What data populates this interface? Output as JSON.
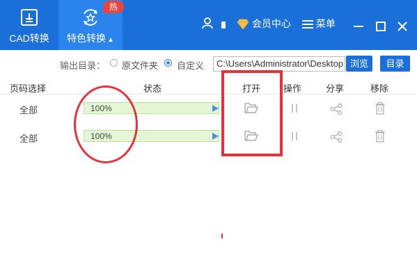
{
  "topbar": {
    "cad_label": "CAD转换",
    "special_label": "特色转换",
    "hot_badge": "热",
    "member_center": "会员中心",
    "menu_label": "菜单",
    "brand_color": "#1b6fd8"
  },
  "output": {
    "label": "输出目录：",
    "options": [
      "原文件夹",
      "自定义"
    ],
    "selected": "自定义",
    "path_value": "C:\\Users\\Administrator\\Desktop",
    "browse_label": "浏览",
    "dir_label": "目录"
  },
  "table": {
    "columns": {
      "page": "页码选择",
      "status": "状态",
      "open": "打开",
      "operate": "操作",
      "share": "分享",
      "remove": "移除"
    },
    "rows": [
      {
        "page": "全部",
        "progress": "100%",
        "progress_value": 100
      },
      {
        "page": "全部",
        "progress": "100%",
        "progress_value": 100
      }
    ]
  },
  "icons": [
    "file-convert-icon",
    "star-convert-icon",
    "user-icon",
    "diamond-icon",
    "menu-icon",
    "minimize-icon",
    "maximize-icon",
    "close-icon",
    "folder-icon",
    "pause-icon",
    "share-icon",
    "trash-icon"
  ]
}
